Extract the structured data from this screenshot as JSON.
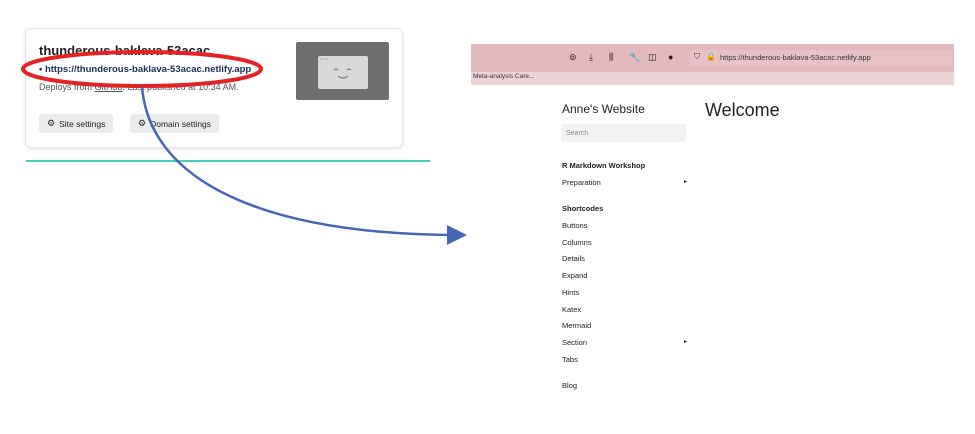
{
  "netlify_card": {
    "site_name": "thunderous-baklava-53acac",
    "url": "https://thunderous-baklava-53acac.netlify.app",
    "bullet": "•",
    "deploy_prefix": "Deploys from ",
    "deploy_source": "GitHub",
    "deploy_suffix": ". Last published at 10:34 AM.",
    "site_settings": "Site settings",
    "domain_settings": "Domain settings",
    "gear_icon": "gear-icon"
  },
  "browser": {
    "address": "https://thunderous-baklava-53acac.netlify.app",
    "bookmark": "Meta-analysis Care...",
    "toolbar_icons": [
      "pocket-icon",
      "download-icon",
      "library-icon",
      "wrench-icon",
      "sidebar-icon",
      "account-icon"
    ],
    "bar_color": "#e3b9be"
  },
  "website": {
    "title": "Anne's Website",
    "search_placeholder": "Search",
    "heading": "Welcome",
    "menu": {
      "workshop": "R Markdown Workshop",
      "preparation": "Preparation",
      "shortcodes": "Shortcodes",
      "buttons": "Buttons",
      "columns": "Columns",
      "details": "Details",
      "expand": "Expand",
      "hints": "Hints",
      "katex": "Katex",
      "mermaid": "Mermaid",
      "section": "Section",
      "tabs": "Tabs",
      "blog": "Blog"
    },
    "caret": "▸"
  },
  "annotations": {
    "ellipse_color": "#e32222",
    "arrow_color": "#4466b5",
    "line_color": "#4cc9c4"
  }
}
